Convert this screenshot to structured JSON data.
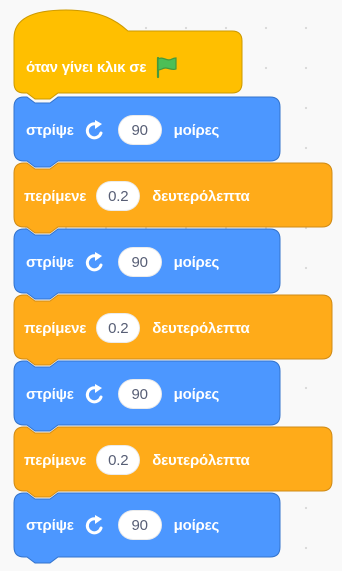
{
  "hat": {
    "label": "όταν γίνει κλικ σε",
    "icon": "green-flag-icon"
  },
  "blocks": [
    {
      "type": "motion",
      "prefix": "στρίψε",
      "icon": "rotate-right-icon",
      "value": "90",
      "suffix": "μοίρες"
    },
    {
      "type": "control",
      "prefix": "περίμενε",
      "value": "0.2",
      "suffix": "δευτερόλεπτα"
    },
    {
      "type": "motion",
      "prefix": "στρίψε",
      "icon": "rotate-right-icon",
      "value": "90",
      "suffix": "μοίρες"
    },
    {
      "type": "control",
      "prefix": "περίμενε",
      "value": "0.2",
      "suffix": "δευτερόλεπτα"
    },
    {
      "type": "motion",
      "prefix": "στρίψε",
      "icon": "rotate-right-icon",
      "value": "90",
      "suffix": "μοίρες"
    },
    {
      "type": "control",
      "prefix": "περίμενε",
      "value": "0.2",
      "suffix": "δευτερόλεπτα"
    },
    {
      "type": "motion",
      "prefix": "στρίψε",
      "icon": "rotate-right-icon",
      "value": "90",
      "suffix": "μοίρες"
    }
  ],
  "colors": {
    "events": "#ffbf00",
    "events_border": "#cc9900",
    "motion": "#4c97ff",
    "motion_border": "#3373cc",
    "control": "#ffab19",
    "control_border": "#cf8b17",
    "flag": "#4cbf56"
  }
}
